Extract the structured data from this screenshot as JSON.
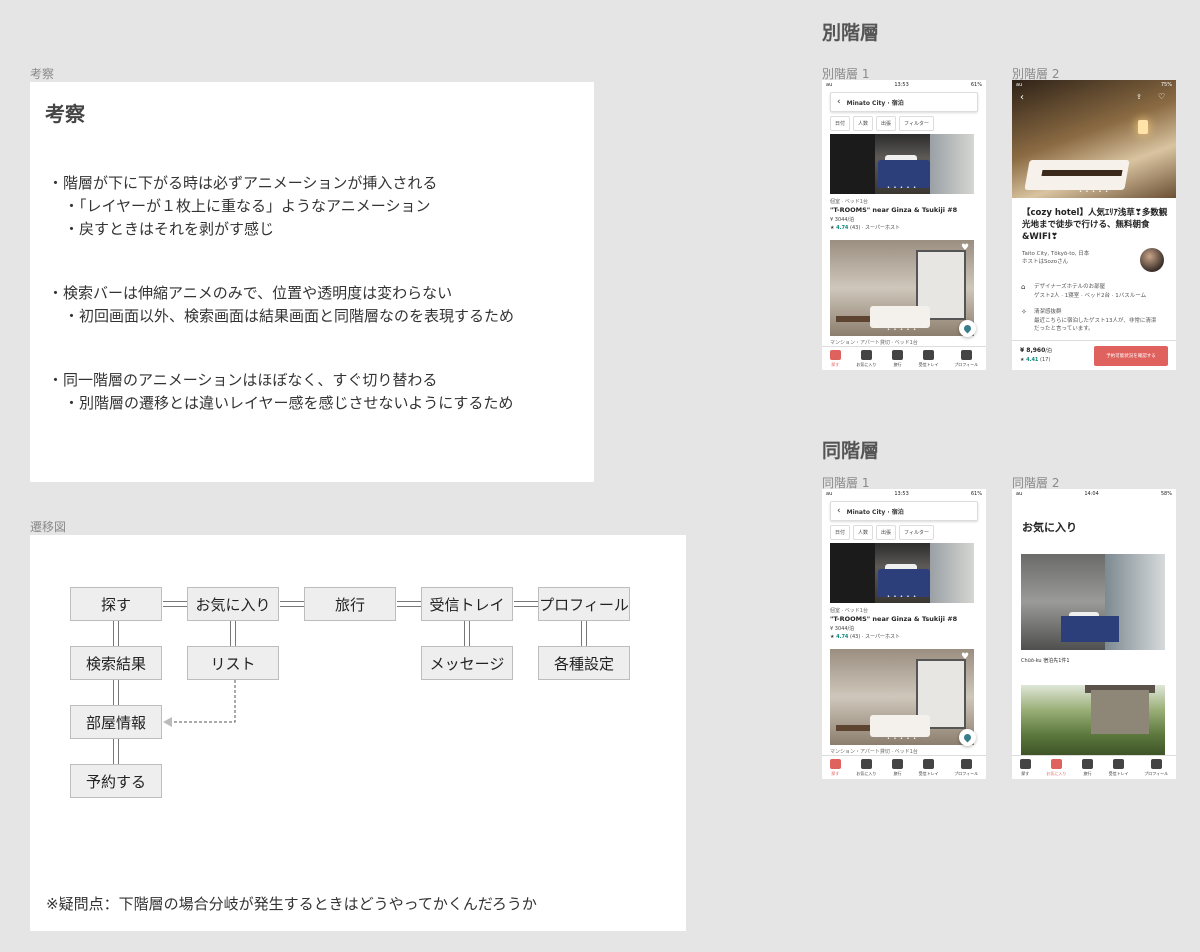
{
  "observation": {
    "label": "考察",
    "title": "考察",
    "bullets": [
      "・階層が下に下がる時は必ずアニメーションが挿入される",
      "・「レイヤーが１枚上に重なる」ようなアニメーション",
      "・戻すときはそれを剥がす感じ",
      "・検索バーは伸縮アニメのみで、位置や透明度は変わらない",
      "・初回画面以外、検索画面は結果画面と同階層なのを表現するため",
      "・同一階層のアニメーションはほぼなく、すぐ切り替わる",
      "・別階層の遷移とは違いレイヤー感を感じさせないようにするため"
    ]
  },
  "diagram": {
    "label": "遷移図",
    "top_nodes": [
      "探す",
      "お気に入り",
      "旅行",
      "受信トレイ",
      "プロフィール"
    ],
    "nodes": {
      "search_results": "検索結果",
      "list": "リスト",
      "room_info": "部屋情報",
      "reserve": "予約する",
      "message": "メッセージ",
      "settings": "各種設定"
    },
    "note": "※疑問点：下階層の場合分岐が発生するときはどうやってかくんだろうか"
  },
  "different_layer": {
    "heading": "別階層",
    "screen1_label": "別階層 1",
    "screen2_label": "別階層 2"
  },
  "same_layer": {
    "heading": "同階層",
    "screen1_label": "同階層 1",
    "screen2_label": "同階層 2"
  },
  "search_screen": {
    "status_time": "13:53",
    "status_carrier": "au",
    "status_battery": "61%",
    "search_text": "Minato City · 宿泊",
    "chips": [
      "日付",
      "人数",
      "出張",
      "フィルター"
    ],
    "listing1_type": "個室 · ベッド1台",
    "listing1_title": "\"T-ROOMS\" near Ginza & Tsukiji #8",
    "listing1_price": "¥ 3044/泊",
    "listing1_rating": "4.74",
    "listing1_rating_rest": "(43) · スーパーホスト",
    "listing2_type": "マンション・アパート貸切 · ベッド1台",
    "photo_dots": "• • • • •",
    "tabs": [
      "探す",
      "お気に入り",
      "旅行",
      "受信トレイ",
      "プロフィール"
    ]
  },
  "detail_screen": {
    "status_battery": "75%",
    "title": "【cozy hotel】人気ｴﾘｱ浅草❣多数観光地まで徒歩で行ける、無料朝食&WIFI❣",
    "location": "Taito City, Tōkyō-to, 日本",
    "host": "ホストはSozoさん",
    "feature1_title": "デザイナーズホテルのお部屋",
    "feature1_sub": "ゲスト2人 · 1寝室 · ベッド2台 · 1バスルーム",
    "feature2_title": "清潔感抜群",
    "feature2_sub1": "最近こちらに宿泊したゲスト13人が、非常に清潔",
    "feature2_sub2": "だったと言っています。",
    "price": "¥ 8,960",
    "price_unit": "/泊",
    "rating": "4.41",
    "rating_rest": "(17)",
    "book_button": "予約可能状況を確認する"
  },
  "favorites_screen": {
    "status_time": "14:04",
    "status_battery": "58%",
    "title": "お気に入り",
    "item1_caption": "Chūō-ku  宿泊先1件1",
    "tabs": [
      "探す",
      "お気に入り",
      "旅行",
      "受信トレイ",
      "プロフィール"
    ]
  },
  "colors": {
    "accent": "#e0625e",
    "rating": "#0a8d7e",
    "background": "#e5e5e5"
  }
}
